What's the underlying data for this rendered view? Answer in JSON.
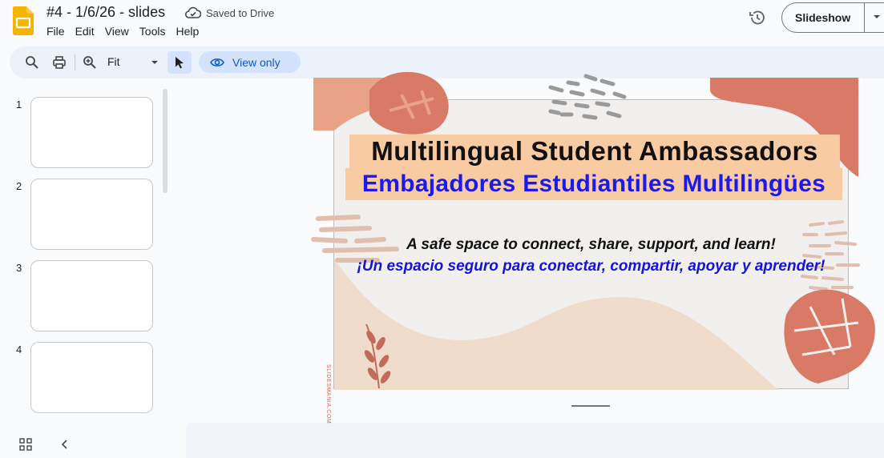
{
  "app": {
    "doc_title": "#4 - 1/6/26 - slides",
    "save_status": "Saved to Drive",
    "logo_icon": "slides-logo-icon",
    "brand_color": "#f4b400"
  },
  "menu": [
    "File",
    "Edit",
    "View",
    "Tools",
    "Help"
  ],
  "header": {
    "slideshow_label": "Slideshow"
  },
  "toolbar": {
    "zoom_value": "Fit",
    "view_only_label": "View only",
    "accent": "#0b57d0"
  },
  "filmstrip": {
    "slides": [
      {
        "number": "1"
      },
      {
        "number": "2"
      },
      {
        "number": "3"
      },
      {
        "number": "4"
      }
    ]
  },
  "slide": {
    "title_en": "Multilingual Student Ambassadors",
    "title_es": "Embajadores Estudiantiles Multilingües",
    "subtitle_en": "A safe space to connect, share, support, and learn!",
    "subtitle_es": "¡Un espacio seguro para conectar, compartir, apoyar y aprender!",
    "credit": "SLIDESMANIA.COM",
    "colors": {
      "title_bg": "#f9cba3",
      "spanish_text": "#1a1aee",
      "terracotta": "#d97a66"
    }
  }
}
